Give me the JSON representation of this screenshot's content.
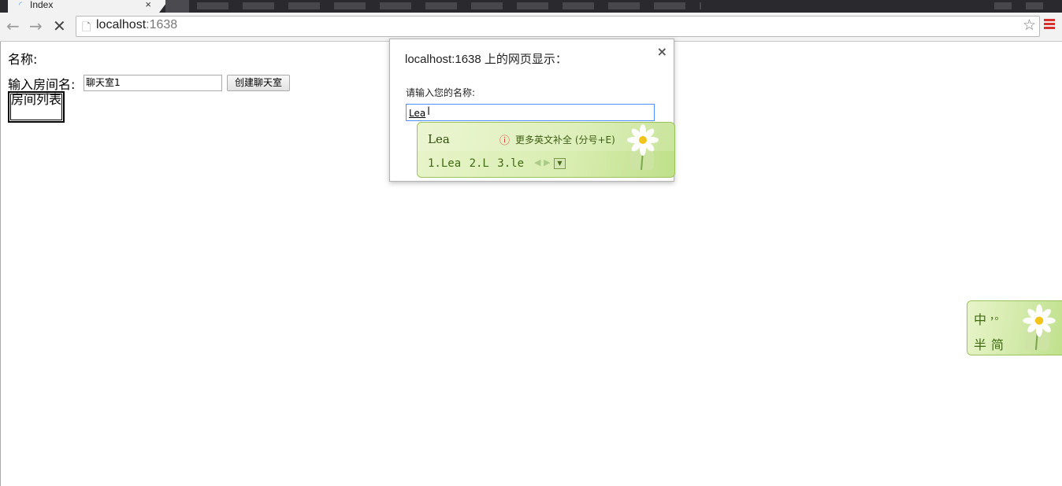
{
  "browser": {
    "tab_title": "Index",
    "tab_close": "×",
    "url_host": "localhost",
    "url_port": ":1638"
  },
  "page": {
    "name_label": "名称:",
    "room_label": "输入房间名:",
    "room_input_value": "聊天室1",
    "create_button": "创建聊天室",
    "room_list_title": "房间列表"
  },
  "dialog": {
    "title": "localhost:1638 上的网页显示：",
    "close": "×",
    "message": "请输入您的名称:",
    "input_value": "Lea"
  },
  "ime": {
    "composition": "Lea",
    "hint": "更多英文补全 (分号+E)",
    "candidates": "1.Lea  2.L  3.le",
    "arrows": "◀ ▶",
    "dropdown": "▼"
  },
  "ime_status": {
    "mode": "中",
    "punct": "，。",
    "width": "半",
    "script": "简"
  },
  "colors": {
    "menu_accent": "#d8302f",
    "dialog_input_border": "#4d90fe",
    "ime_green": "#3f6a12"
  }
}
